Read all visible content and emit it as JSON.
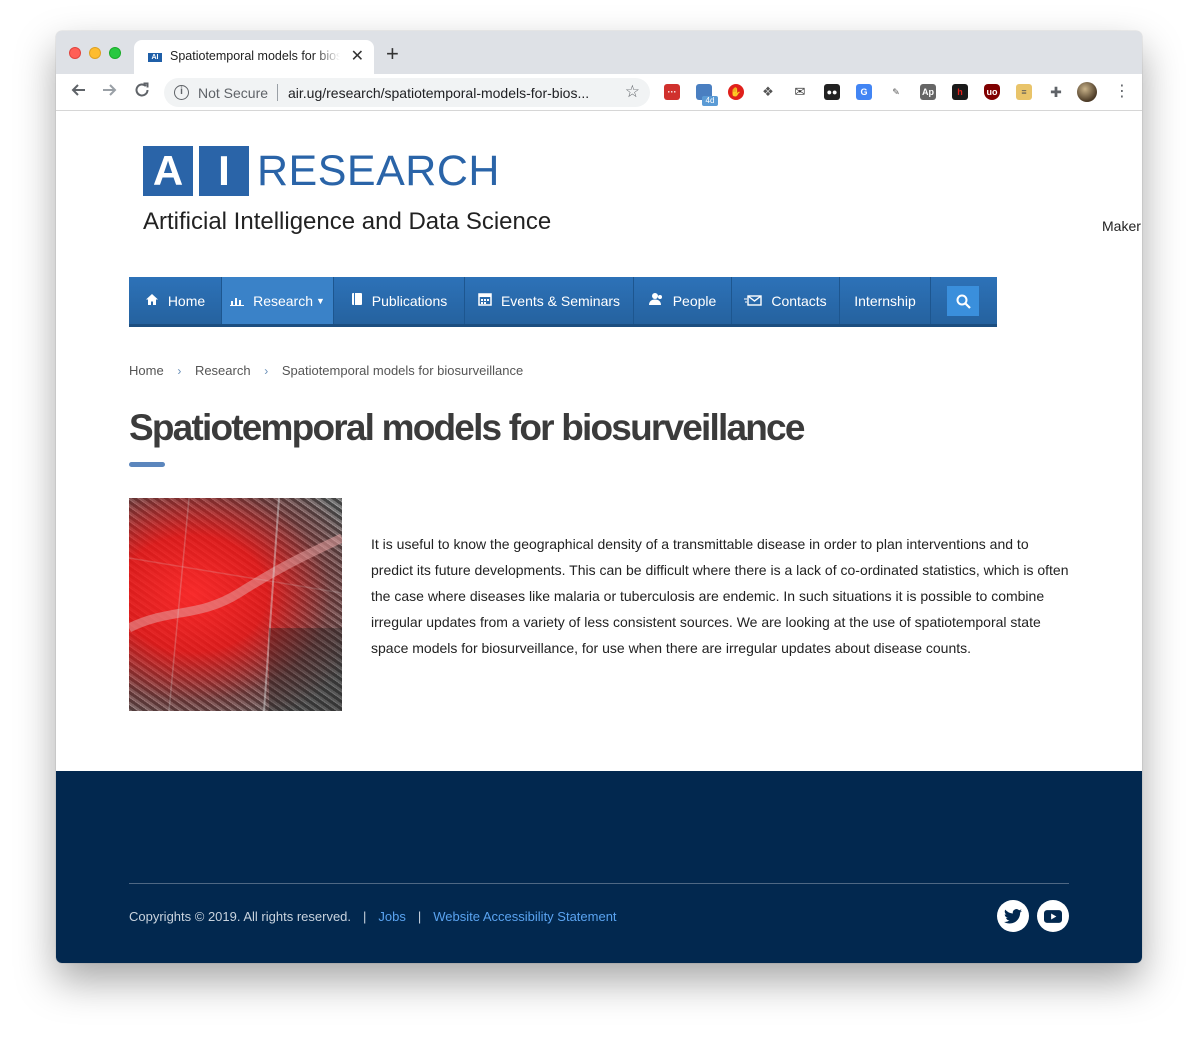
{
  "browser": {
    "tab_title": "Spatiotemporal models for biosurveillance",
    "tab_favicon_text": "AI",
    "new_tab_symbol": "+",
    "close_symbol": "✕",
    "security_label": "Not Secure",
    "url": "air.ug/research/spatiotemporal-models-for-bios...",
    "extension_badge": "4d"
  },
  "site": {
    "logo_letter_a": "A",
    "logo_letter_i": "I",
    "logo_word": "RESEARCH",
    "tagline": "Artificial Intelligence and Data Science",
    "maker_text": "Maker",
    "brand_color": "#2a64a8"
  },
  "nav": {
    "items": [
      {
        "label": "Home",
        "icon": "home-icon"
      },
      {
        "label": "Research",
        "icon": "bar-chart-icon"
      },
      {
        "label": "Publications",
        "icon": "book-icon"
      },
      {
        "label": "Events & Seminars",
        "icon": "calendar-icon"
      },
      {
        "label": "People",
        "icon": "people-icon"
      },
      {
        "label": "Contacts",
        "icon": "envelope-icon"
      },
      {
        "label": "Internship",
        "icon": ""
      }
    ],
    "search_icon": "search-icon"
  },
  "breadcrumb": {
    "items": [
      "Home",
      "Research",
      "Spatiotemporal models for biosurveillance"
    ],
    "separator": "›"
  },
  "article": {
    "title": "Spatiotemporal models for biosurveillance",
    "body": "It is useful to know the geographical density of a transmittable disease in order to plan interventions and to predict its future developments. This can be difficult where there is a lack of co-ordinated statistics, which is often the case where diseases like malaria or tuberculosis are endemic. In such situations it is possible to combine irregular updates from a variety of less consistent sources. We are looking at the use of spatiotemporal state space models for biosurveillance, for use when there are irregular updates about disease counts."
  },
  "footer": {
    "copyright": "Copyrights © 2019. All rights reserved.",
    "pipe": "|",
    "links": [
      "Jobs",
      "Website Accessibility Statement"
    ],
    "social": [
      "twitter-icon",
      "youtube-icon"
    ],
    "background_color": "#02284f"
  }
}
